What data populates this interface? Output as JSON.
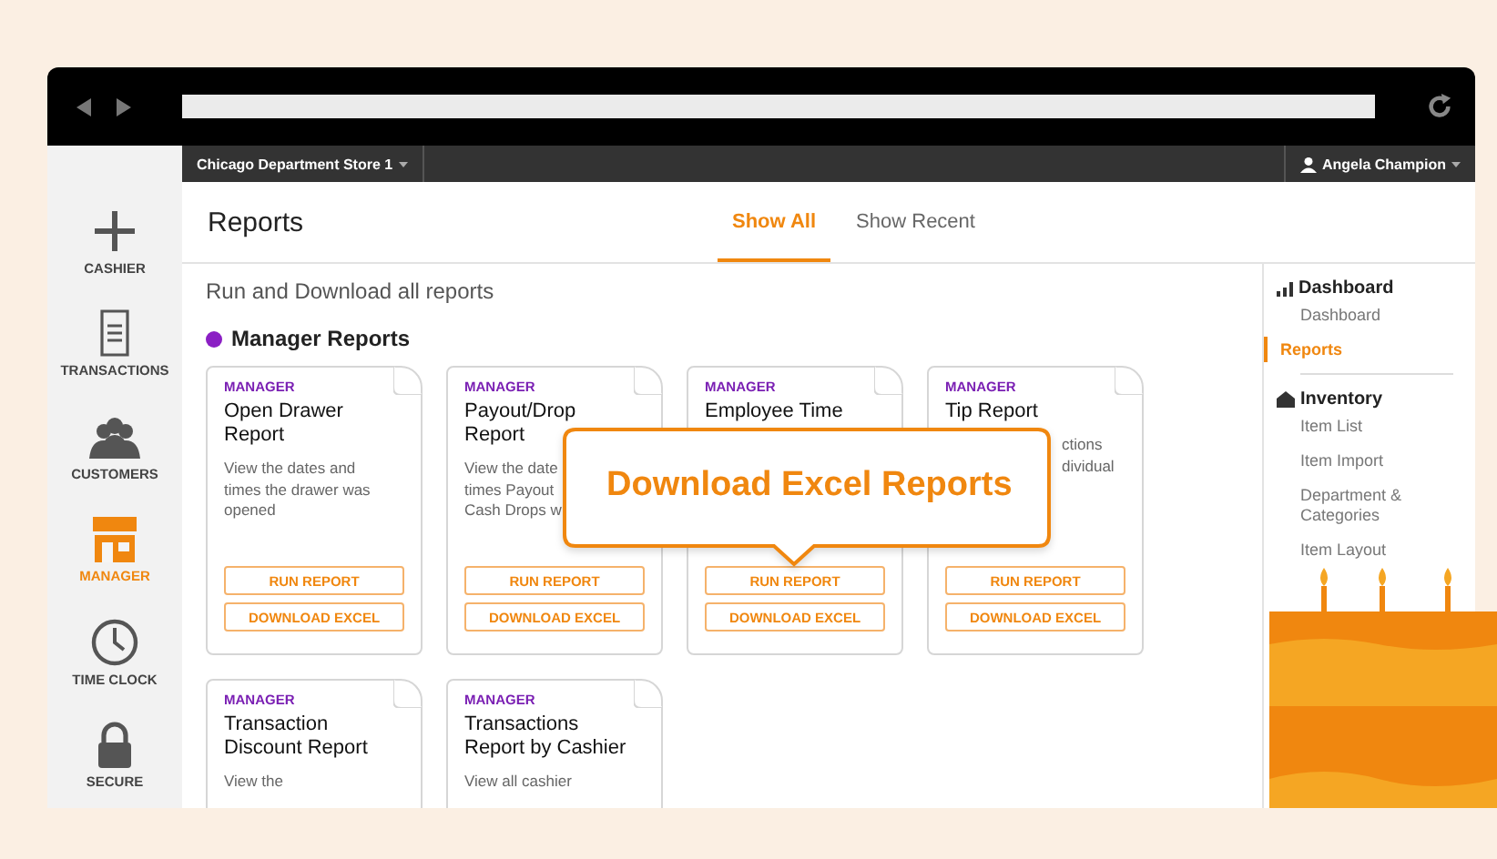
{
  "topbar": {
    "store": "Chicago Department Store 1",
    "user": "Angela Champion"
  },
  "nav": [
    {
      "kind": "plus",
      "label": "CASHIER",
      "selected": false
    },
    {
      "kind": "receipt",
      "label": "TRANSACTIONS",
      "selected": false
    },
    {
      "kind": "people",
      "label": "CUSTOMERS",
      "selected": false
    },
    {
      "kind": "store",
      "label": "MANAGER",
      "selected": true
    },
    {
      "kind": "clock",
      "label": "TIME CLOCK",
      "selected": false
    },
    {
      "kind": "lock",
      "label": "SECURE",
      "selected": false
    }
  ],
  "header": {
    "title": "Reports",
    "tabs": [
      {
        "label": "Show All",
        "selected": true
      },
      {
        "label": "Show Recent",
        "selected": false
      }
    ]
  },
  "intro": "Run and Download all reports",
  "section_title": "Manager Reports",
  "cards": [
    {
      "category": "MANAGER",
      "title": "Open Drawer Report",
      "description": [
        "View the dates and",
        "times the drawer was",
        "opened"
      ],
      "buttons": [
        "RUN REPORT",
        "DOWNLOAD EXCEL"
      ]
    },
    {
      "category": "MANAGER",
      "title": "Payout/Drop Report",
      "description": [
        "View the date",
        "times Payout",
        "Cash Drops w"
      ],
      "buttons": [
        "RUN REPORT",
        "DOWNLOAD EXCEL"
      ]
    },
    {
      "category": "MANAGER",
      "title": "Employee Time",
      "buttons": [
        "RUN REPORT",
        "DOWNLOAD EXCEL"
      ]
    },
    {
      "category": "MANAGER",
      "title": "Tip Report",
      "description": [
        "ctions",
        "dividual"
      ],
      "buttons": [
        "RUN REPORT",
        "DOWNLOAD EXCEL"
      ]
    },
    {
      "category": "MANAGER",
      "title": "Transaction Discount Report",
      "description": [
        "View the"
      ]
    },
    {
      "category": "MANAGER",
      "title": "Transactions Report by Cashier",
      "description": [
        "View all cashier"
      ]
    }
  ],
  "callout": "Download Excel Reports",
  "side_menu": [
    {
      "kind": "group",
      "label": "Dashboard",
      "selected": false,
      "children": [
        {
          "label": "Dashboard",
          "selected": false
        }
      ]
    },
    {
      "kind": "link",
      "label": "Reports",
      "selected": true
    },
    {
      "kind": "group",
      "label": "Inventory",
      "selected": false,
      "children": [
        {
          "label": "Item List",
          "selected": false
        },
        {
          "label": "Item Import",
          "selected": false
        },
        {
          "label": "Department & Categories",
          "selected": false
        },
        {
          "label": "Item Layout",
          "selected": false
        }
      ]
    }
  ]
}
